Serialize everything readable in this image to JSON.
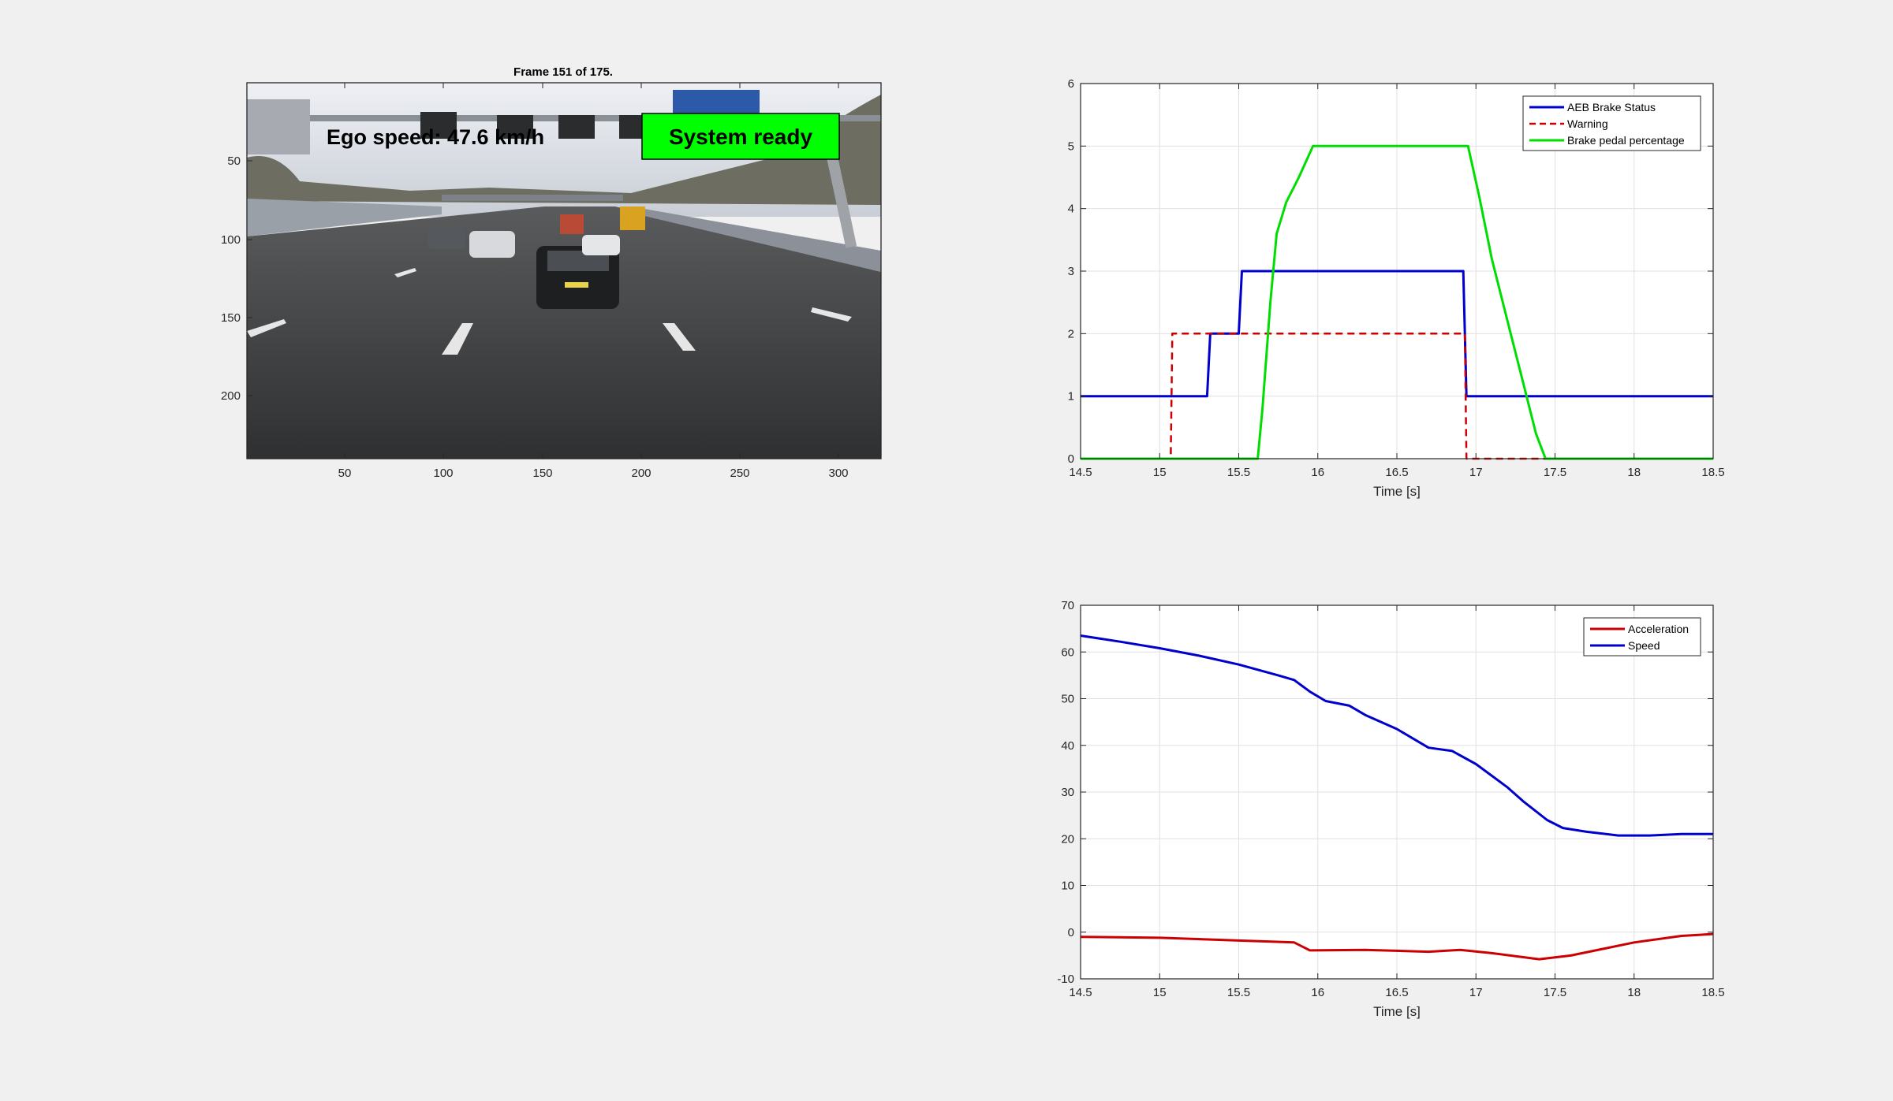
{
  "image_panel": {
    "title": "Frame  151 of 175.",
    "speed_overlay": "Ego speed: 47.6 km/h",
    "status_label": "System ready",
    "status_color": "#00ff00",
    "x_ticks": [
      "50",
      "100",
      "150",
      "200",
      "250",
      "300"
    ],
    "y_ticks": [
      "50",
      "100",
      "150",
      "200"
    ]
  },
  "chart_data": [
    {
      "type": "line",
      "xlabel": "Time [s]",
      "xlim": [
        14.5,
        18.5
      ],
      "ylim": [
        0,
        6
      ],
      "x_ticks": [
        14.5,
        15,
        15.5,
        16,
        16.5,
        17,
        17.5,
        18,
        18.5
      ],
      "y_ticks": [
        0,
        1,
        2,
        3,
        4,
        5,
        6
      ],
      "grid": true,
      "legend_position": "top-right",
      "series": [
        {
          "name": "AEB Brake Status",
          "color": "#0000cc",
          "style": "solid",
          "x": [
            14.5,
            15.3,
            15.32,
            15.5,
            15.52,
            16.92,
            16.94,
            18.5
          ],
          "y": [
            1,
            1,
            2,
            2,
            3,
            3,
            1,
            1
          ]
        },
        {
          "name": "Warning",
          "color": "#cc0000",
          "style": "dashed",
          "x": [
            14.5,
            15.07,
            15.08,
            16.93,
            16.94,
            18.5
          ],
          "y": [
            0,
            0,
            2,
            2,
            0,
            0
          ]
        },
        {
          "name": "Brake pedal percentage",
          "color": "#00dd00",
          "style": "solid",
          "x": [
            14.5,
            15.62,
            15.65,
            15.7,
            15.74,
            15.8,
            15.88,
            15.97,
            16.95,
            17.02,
            17.1,
            17.2,
            17.3,
            17.38,
            17.44,
            18.5
          ],
          "y": [
            0,
            0,
            0.8,
            2.5,
            3.6,
            4.1,
            4.5,
            5,
            5,
            4.2,
            3.2,
            2.2,
            1.2,
            0.4,
            0,
            0
          ]
        }
      ]
    },
    {
      "type": "line",
      "xlabel": "Time [s]",
      "xlim": [
        14.5,
        18.5
      ],
      "ylim": [
        -10,
        70
      ],
      "x_ticks": [
        14.5,
        15,
        15.5,
        16,
        16.5,
        17,
        17.5,
        18,
        18.5
      ],
      "y_ticks": [
        -10,
        0,
        10,
        20,
        30,
        40,
        50,
        60,
        70
      ],
      "grid": true,
      "legend_position": "top-right",
      "series": [
        {
          "name": "Acceleration",
          "color": "#cc0000",
          "style": "solid",
          "x": [
            14.5,
            15.0,
            15.5,
            15.85,
            15.95,
            16.3,
            16.7,
            16.9,
            17.1,
            17.4,
            17.6,
            18.0,
            18.3,
            18.5
          ],
          "y": [
            -1,
            -1.2,
            -1.8,
            -2.2,
            -3.9,
            -3.8,
            -4.2,
            -3.8,
            -4.5,
            -5.8,
            -5.0,
            -2.2,
            -0.8,
            -0.4
          ]
        },
        {
          "name": "Speed",
          "color": "#0000cc",
          "style": "solid",
          "x": [
            14.5,
            14.75,
            15.0,
            15.25,
            15.5,
            15.75,
            15.85,
            15.95,
            16.05,
            16.2,
            16.3,
            16.5,
            16.7,
            16.85,
            17.0,
            17.2,
            17.3,
            17.45,
            17.55,
            17.7,
            17.9,
            18.1,
            18.3,
            18.5
          ],
          "y": [
            63.5,
            62.2,
            60.8,
            59.2,
            57.3,
            55.0,
            54.0,
            51.5,
            49.5,
            48.5,
            46.5,
            43.5,
            39.5,
            38.8,
            36.0,
            31.0,
            28.0,
            24.0,
            22.3,
            21.5,
            20.7,
            20.7,
            21.0,
            21.0
          ]
        }
      ]
    }
  ]
}
